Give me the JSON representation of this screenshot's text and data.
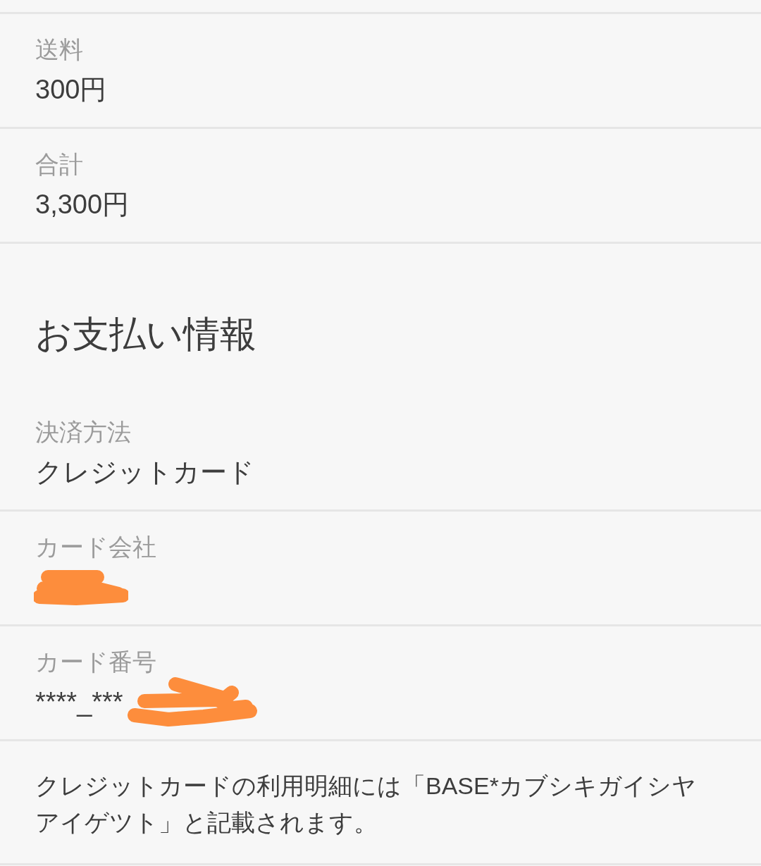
{
  "sections": [
    {
      "rows": [
        {
          "kind": "field",
          "label": "送料",
          "value": "300円",
          "redacted": false
        },
        {
          "kind": "field",
          "label": "合計",
          "value": "3,300円",
          "redacted": false
        }
      ]
    },
    {
      "title": "お支払い情報",
      "rows": [
        {
          "kind": "field",
          "label": "決済方法",
          "value": "クレジットカード",
          "redacted": false
        },
        {
          "kind": "field",
          "label": "カード会社",
          "redacted": true
        },
        {
          "kind": "field",
          "label": "カード番号",
          "value": "****_***",
          "redacted": true
        },
        {
          "kind": "note",
          "text": "クレジットカードの利用明細には「BASE*カブシキガイシヤアイゲツト」と記載されます。"
        }
      ]
    }
  ]
}
